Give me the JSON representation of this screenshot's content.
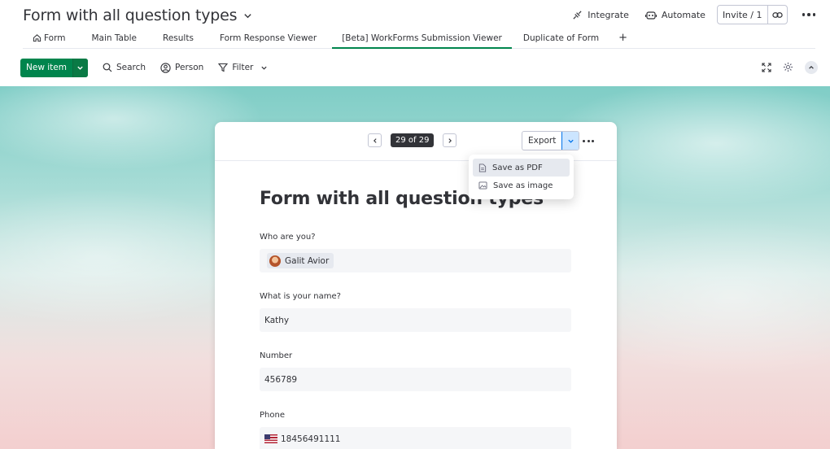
{
  "header": {
    "board_title": "Form with all question types",
    "integrate_label": "Integrate",
    "automate_label": "Automate",
    "invite_label": "Invite / 1"
  },
  "tabs": [
    {
      "label": "Form",
      "icon": "home-icon"
    },
    {
      "label": "Main Table"
    },
    {
      "label": "Results"
    },
    {
      "label": "Form Response Viewer"
    },
    {
      "label": "[Beta] WorkForms Submission Viewer",
      "active": true
    },
    {
      "label": "Duplicate of Form"
    },
    {
      "label": "+"
    }
  ],
  "toolbar": {
    "new_item_label": "New item",
    "search_label": "Search",
    "person_label": "Person",
    "filter_label": "Filter"
  },
  "viewer": {
    "pager_text": "29 of 29",
    "export_label": "Export",
    "export_menu": [
      "Save as PDF",
      "Save as image"
    ]
  },
  "form": {
    "title": "Form with all question types",
    "fields": [
      {
        "label": "Who are you?",
        "value": "Galit Avior",
        "type": "person"
      },
      {
        "label": "What is your name?",
        "value": "Kathy"
      },
      {
        "label": "Number",
        "value": "456789"
      },
      {
        "label": "Phone",
        "value": "18456491111",
        "type": "phone"
      }
    ]
  },
  "colors": {
    "accent_green": "#00854d",
    "selected_blue": "#cce5ff",
    "text": "#323338"
  }
}
